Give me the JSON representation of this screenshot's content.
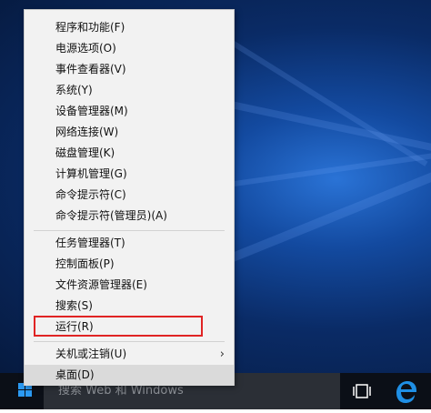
{
  "menu": {
    "groups": [
      [
        {
          "label": "程序和功能(F)"
        },
        {
          "label": "电源选项(O)"
        },
        {
          "label": "事件查看器(V)"
        },
        {
          "label": "系统(Y)"
        },
        {
          "label": "设备管理器(M)"
        },
        {
          "label": "网络连接(W)"
        },
        {
          "label": "磁盘管理(K)"
        },
        {
          "label": "计算机管理(G)"
        },
        {
          "label": "命令提示符(C)"
        },
        {
          "label": "命令提示符(管理员)(A)"
        }
      ],
      [
        {
          "label": "任务管理器(T)"
        },
        {
          "label": "控制面板(P)"
        },
        {
          "label": "文件资源管理器(E)"
        },
        {
          "label": "搜索(S)"
        },
        {
          "label": "运行(R)",
          "highlighted": true
        }
      ],
      [
        {
          "label": "关机或注销(U)",
          "submenu": true
        },
        {
          "label": "桌面(D)",
          "hover": true
        }
      ]
    ],
    "highlight_color": "#e02424"
  },
  "taskbar": {
    "search_text": "搜索 Web 和 Windows",
    "icons": [
      "windows-start-icon",
      "task-view-icon",
      "edge-icon"
    ],
    "accent": "#2b9af3"
  }
}
